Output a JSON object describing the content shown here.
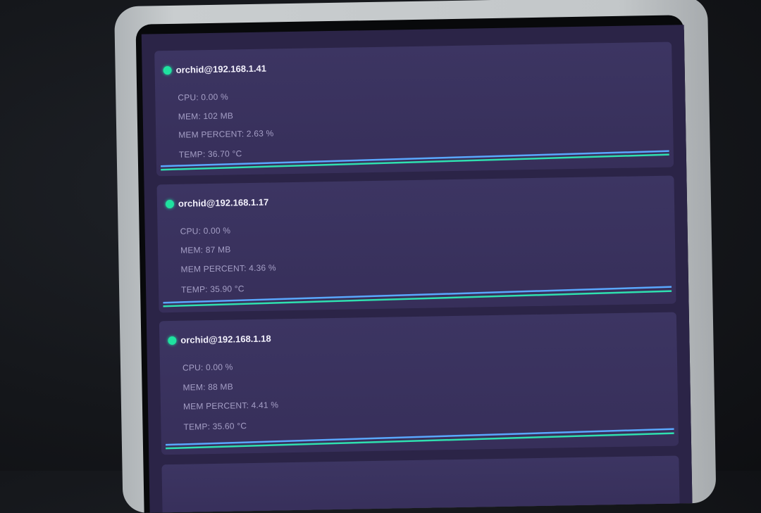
{
  "servers": [
    {
      "name": "orchid@192.168.1.41",
      "status": "online",
      "cpu": "CPU: 0.00 %",
      "mem": "MEM: 102 MB",
      "mem_percent": "MEM PERCENT: 2.63 %",
      "temp": "TEMP: 36.70 °C"
    },
    {
      "name": "orchid@192.168.1.17",
      "status": "online",
      "cpu": "CPU: 0.00 %",
      "mem": "MEM: 87 MB",
      "mem_percent": "MEM PERCENT: 4.36 %",
      "temp": "TEMP: 35.90 °C"
    },
    {
      "name": "orchid@192.168.1.18",
      "status": "online",
      "cpu": "CPU: 0.00 %",
      "mem": "MEM: 88 MB",
      "mem_percent": "MEM PERCENT: 4.41 %",
      "temp": "TEMP: 35.60 °C"
    }
  ],
  "colors": {
    "status_online": "#1fe2a0",
    "graph_line_blue": "#5aa8ff",
    "graph_line_green": "#2fe0b0",
    "card_bg": "#3a335f",
    "screen_bg": "#2b2447"
  }
}
